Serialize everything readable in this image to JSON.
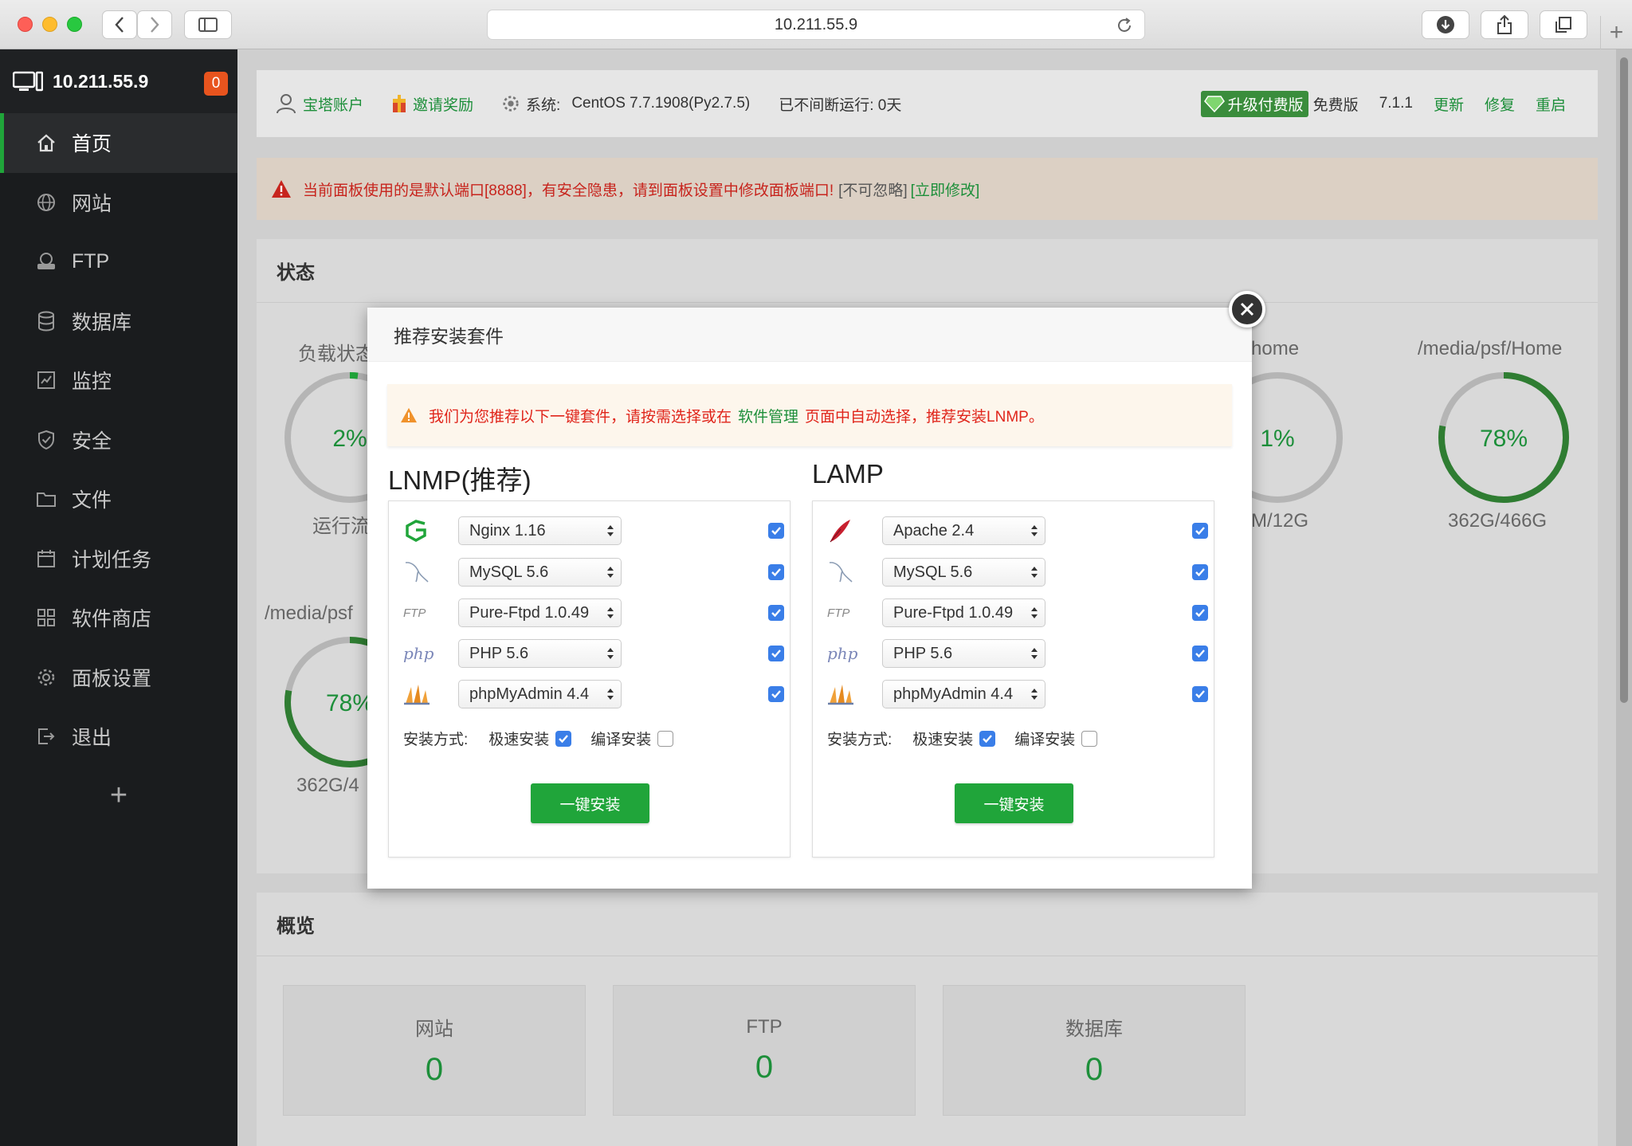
{
  "browser": {
    "url": "10.211.55.9",
    "new_tab": "+"
  },
  "sidebar": {
    "host": "10.211.55.9",
    "badge": "0",
    "items": [
      {
        "label": "首页",
        "icon": "home-icon",
        "active": true
      },
      {
        "label": "网站",
        "icon": "globe-icon"
      },
      {
        "label": "FTP",
        "icon": "ftp-icon"
      },
      {
        "label": "数据库",
        "icon": "database-icon"
      },
      {
        "label": "监控",
        "icon": "monitor-icon"
      },
      {
        "label": "安全",
        "icon": "shield-icon"
      },
      {
        "label": "文件",
        "icon": "folder-icon"
      },
      {
        "label": "计划任务",
        "icon": "calendar-icon"
      },
      {
        "label": "软件商店",
        "icon": "grid-icon"
      },
      {
        "label": "面板设置",
        "icon": "gear-icon"
      },
      {
        "label": "退出",
        "icon": "logout-icon"
      }
    ],
    "add": "+"
  },
  "topbar": {
    "account": "宝塔账户",
    "invite": "邀请奖励",
    "system_label": "系统:",
    "system_value": "CentOS 7.7.1908(Py2.7.5)",
    "uptime": "已不间断运行: 0天",
    "upgrade": "升级付费版",
    "edition": "免费版",
    "version": "7.1.1",
    "update": "更新",
    "repair": "修复",
    "restart": "重启"
  },
  "alert": {
    "text": "当前面板使用的是默认端口[8888]，有安全隐患，请到面板设置中修改面板端口!",
    "ignore": "[不可忽略]",
    "fix": "[立即修改]"
  },
  "status": {
    "title": "状态",
    "load_label": "负载状态",
    "load_value": "2%",
    "load_sub": "运行流",
    "disk1_label": "home",
    "disk1_value": "1%",
    "disk1_sub": "M/12G",
    "disk2_label": "/media/psf/Home",
    "disk2_value": "78%",
    "disk2_sub": "362G/466G",
    "disk3_label": "/media/psf",
    "disk3_value": "78%",
    "disk3_sub": "362G/4",
    "gauge_color": "#20a53a"
  },
  "overview": {
    "title": "概览",
    "cards": [
      {
        "label": "网站",
        "value": "0"
      },
      {
        "label": "FTP",
        "value": "0"
      },
      {
        "label": "数据库",
        "value": "0"
      }
    ]
  },
  "modal": {
    "title": "推荐安装套件",
    "notice_pre": "我们为您推荐以下一键套件，请按需选择或在",
    "notice_link": "软件管理",
    "notice_post": "页面中自动选择，推荐安装LNMP。",
    "lnmp": {
      "title": "LNMP(推荐)",
      "rows": [
        "Nginx 1.16",
        "MySQL 5.6",
        "Pure-Ftpd 1.0.49",
        "PHP 5.6",
        "phpMyAdmin 4.4"
      ],
      "method_label": "安装方式:",
      "fast": "极速安装",
      "compile": "编译安装",
      "install": "一键安装"
    },
    "lamp": {
      "title": "LAMP",
      "rows": [
        "Apache 2.4",
        "MySQL 5.6",
        "Pure-Ftpd 1.0.49",
        "PHP 5.6",
        "phpMyAdmin 4.4"
      ],
      "method_label": "安装方式:",
      "fast": "极速安装",
      "compile": "编译安装",
      "install": "一键安装"
    },
    "logos": {
      "ftp": "FTP",
      "php": "php"
    }
  },
  "colors": {
    "accent": "#20a53a",
    "alert": "#c7241d",
    "checkbox": "#3a7ee8"
  }
}
